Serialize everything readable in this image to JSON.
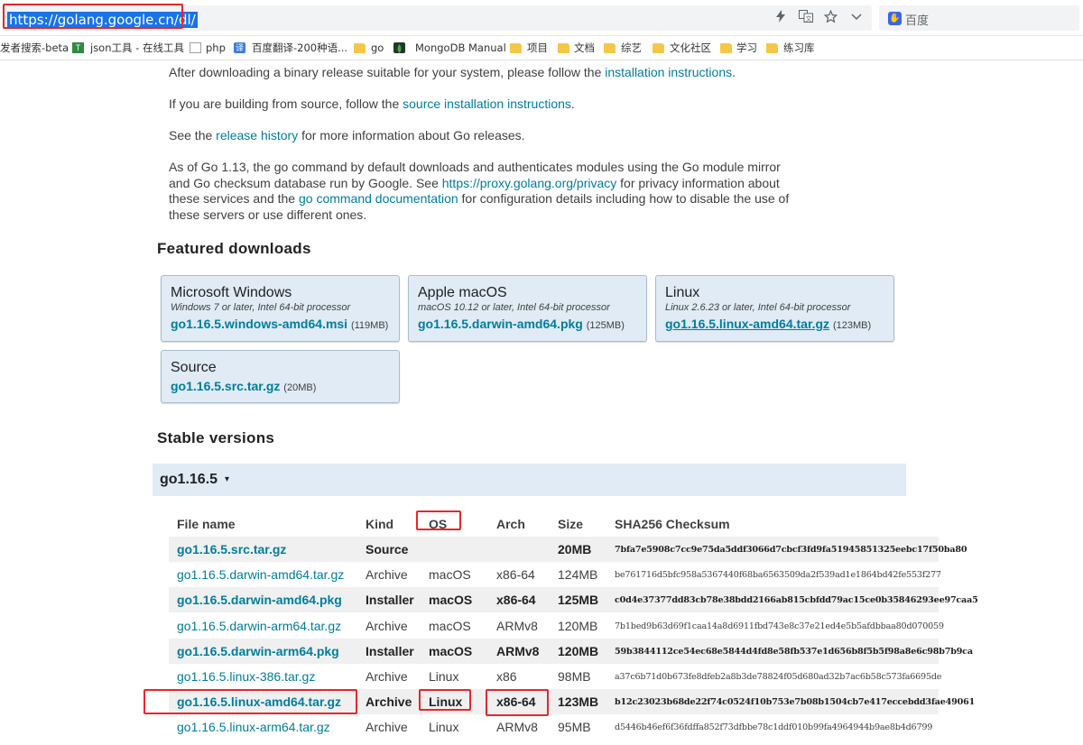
{
  "browser": {
    "url": "https://golang.google.cn/dl/",
    "search_engine": "百度",
    "bookmarks": [
      {
        "label": "发者搜索-beta",
        "icon": "none"
      },
      {
        "label": "json工具 - 在线工具",
        "icon": "json-icon"
      },
      {
        "label": "php",
        "icon": "page-icon"
      },
      {
        "label": "百度翻译-200种语...",
        "icon": "translate-icon"
      },
      {
        "label": "go",
        "icon": "folder-icon"
      },
      {
        "label": "MongoDB Manual",
        "icon": "mongodb-icon"
      },
      {
        "label": "项目",
        "icon": "folder-icon"
      },
      {
        "label": "文档",
        "icon": "folder-icon"
      },
      {
        "label": "综艺",
        "icon": "folder-icon"
      },
      {
        "label": "文化社区",
        "icon": "folder-icon"
      },
      {
        "label": "学习",
        "icon": "folder-icon"
      },
      {
        "label": "练习库",
        "icon": "folder-icon"
      }
    ]
  },
  "intro": {
    "p1_before": "After downloading a binary release suitable for your system, please follow the ",
    "p1_link": "installation instructions",
    "p1_after": ".",
    "p2_before": "If you are building from source, follow the ",
    "p2_link": "source installation instructions",
    "p2_after": ".",
    "p3_before": "See the ",
    "p3_link": "release history",
    "p3_after": " for more information about Go releases.",
    "p4_a": "As of Go 1.13, the go command by default downloads and authenticates modules using the Go module mirror and Go checksum database run by Google. See ",
    "p4_link1": "https://proxy.golang.org/privacy",
    "p4_b": " for privacy information about these services and the ",
    "p4_link2": "go command documentation",
    "p4_c": " for configuration details including how to disable the use of these servers or use different ones."
  },
  "featured": {
    "heading": "Featured downloads",
    "cards": [
      {
        "os": "Microsoft Windows",
        "req": "Windows 7 or later, Intel 64-bit processor",
        "file": "go1.16.5.windows-amd64.msi",
        "size": "(119MB)"
      },
      {
        "os": "Apple macOS",
        "req": "macOS 10.12 or later, Intel 64-bit processor",
        "file": "go1.16.5.darwin-amd64.pkg",
        "size": "(125MB)"
      },
      {
        "os": "Linux",
        "req": "Linux 2.6.23 or later, Intel 64-bit processor",
        "file": "go1.16.5.linux-amd64.tar.gz",
        "size": "(123MB)"
      },
      {
        "os": "Source",
        "req": "",
        "file": "go1.16.5.src.tar.gz",
        "size": "(20MB)"
      }
    ]
  },
  "stable": {
    "heading": "Stable versions",
    "version": "go1.16.5",
    "caret": "▾",
    "columns": [
      "File name",
      "Kind",
      "OS",
      "Arch",
      "Size",
      "SHA256 Checksum"
    ],
    "rows": [
      {
        "file": "go1.16.5.src.tar.gz",
        "kind": "Source",
        "os": "",
        "arch": "",
        "size": "20MB",
        "sha": "7bfa7e5908c7cc9e75da5ddf3066d7cbcf3fd9fa51945851325eebc17f50ba80",
        "highlight": true
      },
      {
        "file": "go1.16.5.darwin-amd64.tar.gz",
        "kind": "Archive",
        "os": "macOS",
        "arch": "x86-64",
        "size": "124MB",
        "sha": "be761716d5bfc958a5367440f68ba6563509da2f539ad1e1864bd42fe553f277",
        "highlight": false
      },
      {
        "file": "go1.16.5.darwin-amd64.pkg",
        "kind": "Installer",
        "os": "macOS",
        "arch": "x86-64",
        "size": "125MB",
        "sha": "c0d4e37377dd83cb78e38bdd2166ab815cbfdd79ac15ce0b35846293ee97caa5",
        "highlight": true
      },
      {
        "file": "go1.16.5.darwin-arm64.tar.gz",
        "kind": "Archive",
        "os": "macOS",
        "arch": "ARMv8",
        "size": "120MB",
        "sha": "7b1bed9b63d69f1caa14a8d6911fbd743e8c37e21ed4e5b5afdbbaa80d070059",
        "highlight": false
      },
      {
        "file": "go1.16.5.darwin-arm64.pkg",
        "kind": "Installer",
        "os": "macOS",
        "arch": "ARMv8",
        "size": "120MB",
        "sha": "59b3844112ce54ec68e5844d4fd8e58fb537e1d656b8f5b5f98a8e6c98b7b9ca",
        "highlight": true
      },
      {
        "file": "go1.16.5.linux-386.tar.gz",
        "kind": "Archive",
        "os": "Linux",
        "arch": "x86",
        "size": "98MB",
        "sha": "a37c6b71d0b673fe8dfeb2a8b3de78824f05d680ad32b7ac6b58c573fa6695de",
        "highlight": false
      },
      {
        "file": "go1.16.5.linux-amd64.tar.gz",
        "kind": "Archive",
        "os": "Linux",
        "arch": "x86-64",
        "size": "123MB",
        "sha": "b12c23023b68de22f74c0524f10b753e7b08b1504cb7e417eccebdd3fae49061",
        "highlight": true
      },
      {
        "file": "go1.16.5.linux-arm64.tar.gz",
        "kind": "Archive",
        "os": "Linux",
        "arch": "ARMv8",
        "size": "95MB",
        "sha": "d5446b46ef6f36fdffa852f73dfbbe78c1ddf010b99fa4964944b9ae8b4d6799",
        "highlight": false
      }
    ]
  },
  "colors": {
    "link": "#007d9c",
    "card_bg": "#e0ebf5",
    "annotation_red": "#e8262c",
    "selection_blue": "#1a73e8"
  }
}
